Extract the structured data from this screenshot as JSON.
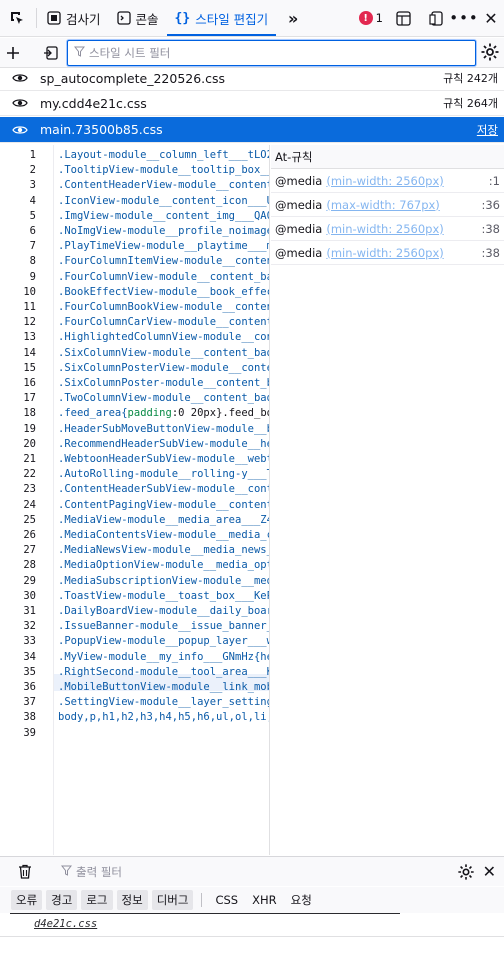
{
  "toolbar": {
    "tabs": [
      {
        "label": "검사기",
        "icon": "inspector-icon"
      },
      {
        "label": "콘솔",
        "icon": "console-icon"
      },
      {
        "label": "스타일 편집기",
        "icon": "style-editor-icon",
        "selected": true
      }
    ],
    "error_count": "1"
  },
  "filter": {
    "placeholder": "스타일 시트 필터"
  },
  "sheets": [
    {
      "name": "sp_autocomplete_220526.css",
      "rules": "규칙 242개"
    },
    {
      "name": "my.cdd4e21c.css",
      "rules": "규칙 264개"
    },
    {
      "name": "main.73500b85.css",
      "rules": "저장",
      "selected": true
    }
  ],
  "editor": {
    "line_numbers": [
      "1",
      "2",
      "3",
      "4",
      "5",
      "6",
      "7",
      "8",
      "9",
      "10",
      "11",
      "12",
      "13",
      "14",
      "15",
      "16",
      "17",
      "18",
      "19",
      "20",
      "21",
      "22",
      "23",
      "24",
      "25",
      "26",
      "27",
      "28",
      "29",
      "30",
      "31",
      "32",
      "33",
      "34",
      "35",
      "36",
      "37",
      "38",
      "39"
    ],
    "lines": [
      ".Layout-module__column_left___tLO23",
      ".TooltipView-module__tooltip_box___",
      ".ContentHeaderView-module__content_",
      ".IconView-module__content_icon___US",
      ".ImgView-module__content_img___QA0g",
      ".NoImgView-module__profile_noimage_",
      ".PlayTimeView-module__playtime___mj",
      ".FourColumnItemView-module__content",
      ".FourColumnView-module__content_bad",
      ".BookEffectView-module__book_effect",
      ".FourColumnBookView-module__content",
      ".FourColumnCarView-module__content_",
      ".HighlightedColumnView-module__cont",
      ".SixColumnView-module__content_badg",
      ".SixColumnPosterView-module__conten",
      ".SixColumnPoster-module__content_ba",
      ".TwoColumnView-module__content_badg",
      ".feed_area{padding:0 20px}.feed_box",
      ".HeaderSubMoveButtonView-module__bt",
      ".RecommendHeaderSubView-module__hea",
      ".WebtoonHeaderSubView-module__webto",
      ".AutoRolling-module__rolling-y___T3",
      ".ContentHeaderSubView-module__conte",
      ".ContentPagingView-module__content_",
      ".MediaView-module__media_area___Z4j",
      ".MediaContentsView-module__media_co",
      ".MediaNewsView-module__media_news__",
      ".MediaOptionView-module__media_opti",
      ".MediaSubscriptionView-module__medi",
      ".ToastView-module__toast_box___KePv",
      ".DailyBoardView-module__daily_board",
      ".IssueBanner-module__issue_banner_a",
      ".PopupView-module__popup_layer___w_",
      ".MyView-module__my_info___GNmHz{hei",
      ".RightSecond-module__tool_area___KO",
      ".MobileButtonView-module__link_mobi",
      ".SettingView-module__layer_setting_",
      "body,p,h1,h2,h3,h4,h5,h6,ul,ol,li,d",
      ""
    ]
  },
  "at_rules": {
    "header": "At-규칙",
    "rows": [
      {
        "keyword": "@media",
        "condition": "(min-width: 2560px)",
        "line": ":1"
      },
      {
        "keyword": "@media",
        "condition": "(max-width: 767px)",
        "line": ":36"
      },
      {
        "keyword": "@media",
        "condition": "(min-width: 2560px)",
        "line": ":38"
      },
      {
        "keyword": "@media",
        "condition": "(min-width: 2560px)",
        "line": ":38"
      }
    ]
  },
  "console": {
    "filter_placeholder": "출력 필터",
    "levels": [
      "오류",
      "경고",
      "로그",
      "정보",
      "디버그"
    ],
    "types": [
      "CSS",
      "XHR",
      "요청"
    ],
    "message": "d4e21c.css"
  },
  "colors": {
    "accent": "#0061e0",
    "selected_row": "#0a6bdc",
    "error": "#e22850"
  }
}
